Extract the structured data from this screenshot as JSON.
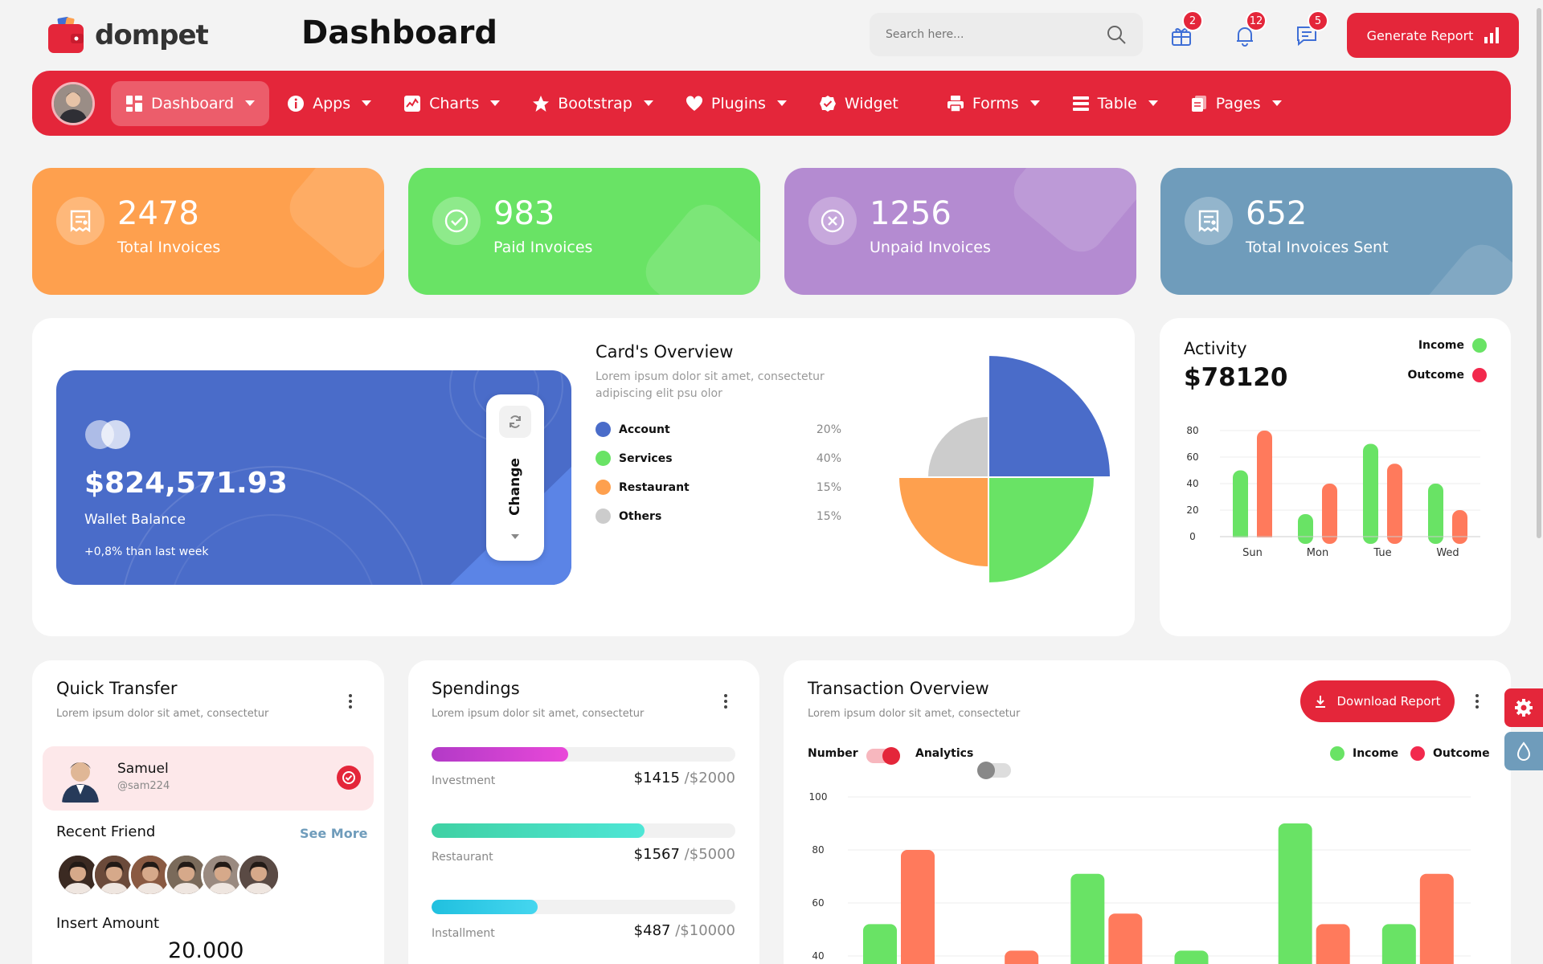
{
  "app": {
    "brand": "dompet",
    "page_title": "Dashboard"
  },
  "header": {
    "search_placeholder": "Search here...",
    "badges": {
      "gift": "2",
      "bell": "12",
      "chat": "5"
    },
    "generate_label": "Generate Report"
  },
  "nav": [
    {
      "label": "Dashboard",
      "icon": "grid-icon",
      "active": true,
      "caret": true
    },
    {
      "label": "Apps",
      "icon": "info-icon",
      "caret": true
    },
    {
      "label": "Charts",
      "icon": "chart-icon",
      "caret": true
    },
    {
      "label": "Bootstrap",
      "icon": "star-icon",
      "caret": true
    },
    {
      "label": "Plugins",
      "icon": "heart-icon",
      "caret": true
    },
    {
      "label": "Widget",
      "icon": "badge-check-icon",
      "caret": false
    },
    {
      "label": "Forms",
      "icon": "printer-icon",
      "caret": true
    },
    {
      "label": "Table",
      "icon": "list-icon",
      "caret": true
    },
    {
      "label": "Pages",
      "icon": "pages-icon",
      "caret": true
    }
  ],
  "stats": [
    {
      "value": "2478",
      "label": "Total Invoices",
      "color": "#fea04e"
    },
    {
      "value": "983",
      "label": "Paid Invoices",
      "color": "#69e365"
    },
    {
      "value": "1256",
      "label": "Unpaid Invoices",
      "color": "#b48bd1"
    },
    {
      "value": "652",
      "label": "Total Invoices Sent",
      "color": "#6f9cbb"
    }
  ],
  "wallet": {
    "amount": "$824,571.93",
    "label": "Wallet Balance",
    "change": "+0,8% than last week",
    "change_btn": "Change"
  },
  "cards_overview": {
    "title": "Card's Overview",
    "subtitle": "Lorem ipsum dolor sit amet, consectetur adipiscing elit psu olor",
    "items": [
      {
        "name": "Account",
        "pct": "20%",
        "color": "#4a6cc9"
      },
      {
        "name": "Services",
        "pct": "40%",
        "color": "#69e365"
      },
      {
        "name": "Restaurant",
        "pct": "15%",
        "color": "#fea04e"
      },
      {
        "name": "Others",
        "pct": "15%",
        "color": "#cccccc"
      }
    ]
  },
  "activity": {
    "title": "Activity",
    "value": "$78120",
    "income_label": "Income",
    "outcome_label": "Outcome"
  },
  "quick_transfer": {
    "title": "Quick Transfer",
    "subtitle": "Lorem ipsum dolor sit amet, consectetur",
    "user_name": "Samuel",
    "user_handle": "@sam224",
    "recent_title": "Recent Friend",
    "see_more": "See More",
    "insert_label": "Insert Amount",
    "amount": "20.000"
  },
  "spendings": {
    "title": "Spendings",
    "subtitle": "Lorem ipsum dolor sit amet, consectetur",
    "items": [
      {
        "label": "Investment",
        "value": "$1415",
        "of": "/$2000",
        "progress": 0.45,
        "gradient": "linear-gradient(90deg,#b23ac7,#e948d9)"
      },
      {
        "label": "Restaurant",
        "value": "$1567",
        "of": "/$5000",
        "progress": 0.7,
        "gradient": "linear-gradient(90deg,#3fd1a3,#4ee6d6)"
      },
      {
        "label": "Installment",
        "value": "$487",
        "of": "/$10000",
        "progress": 0.35,
        "gradient": "linear-gradient(90deg,#20c0df,#45d6ef)"
      }
    ]
  },
  "transaction": {
    "title": "Transaction Overview",
    "subtitle": "Lorem ipsum dolor sit amet, consectetur",
    "download_label": "Download Report",
    "number_label": "Number",
    "analytics_label": "Analytics",
    "income_label": "Income",
    "outcome_label": "Outcome"
  },
  "chart_data": [
    {
      "type": "pie",
      "categories": [
        "Account",
        "Services",
        "Restaurant",
        "Others"
      ],
      "values": [
        20,
        40,
        15,
        15
      ],
      "colors": [
        "#4a6cc9",
        "#69e365",
        "#fea04e",
        "#cccccc"
      ]
    },
    {
      "type": "bar",
      "categories": [
        "Sun",
        "Mon",
        "Tue",
        "Wed"
      ],
      "yticks": [
        "0",
        "20",
        "40",
        "60",
        "80"
      ],
      "ylim": [
        0,
        80
      ],
      "series": [
        {
          "name": "Income",
          "color": "#69e365",
          "values": [
            50,
            17,
            70,
            40
          ]
        },
        {
          "name": "Outcome",
          "color": "#ff7a5c",
          "values": [
            80,
            40,
            55,
            20
          ]
        }
      ]
    },
    {
      "type": "bar",
      "yticks": [
        "40",
        "60",
        "80",
        "100"
      ],
      "ylim": [
        40,
        100
      ],
      "series": [
        {
          "name": "Income",
          "color": "#69e365",
          "values": [
            52,
            0,
            71,
            42,
            90,
            52
          ]
        },
        {
          "name": "Outcome",
          "color": "#ff7a5c",
          "values": [
            80,
            42,
            56,
            0,
            52,
            71
          ]
        }
      ]
    }
  ]
}
